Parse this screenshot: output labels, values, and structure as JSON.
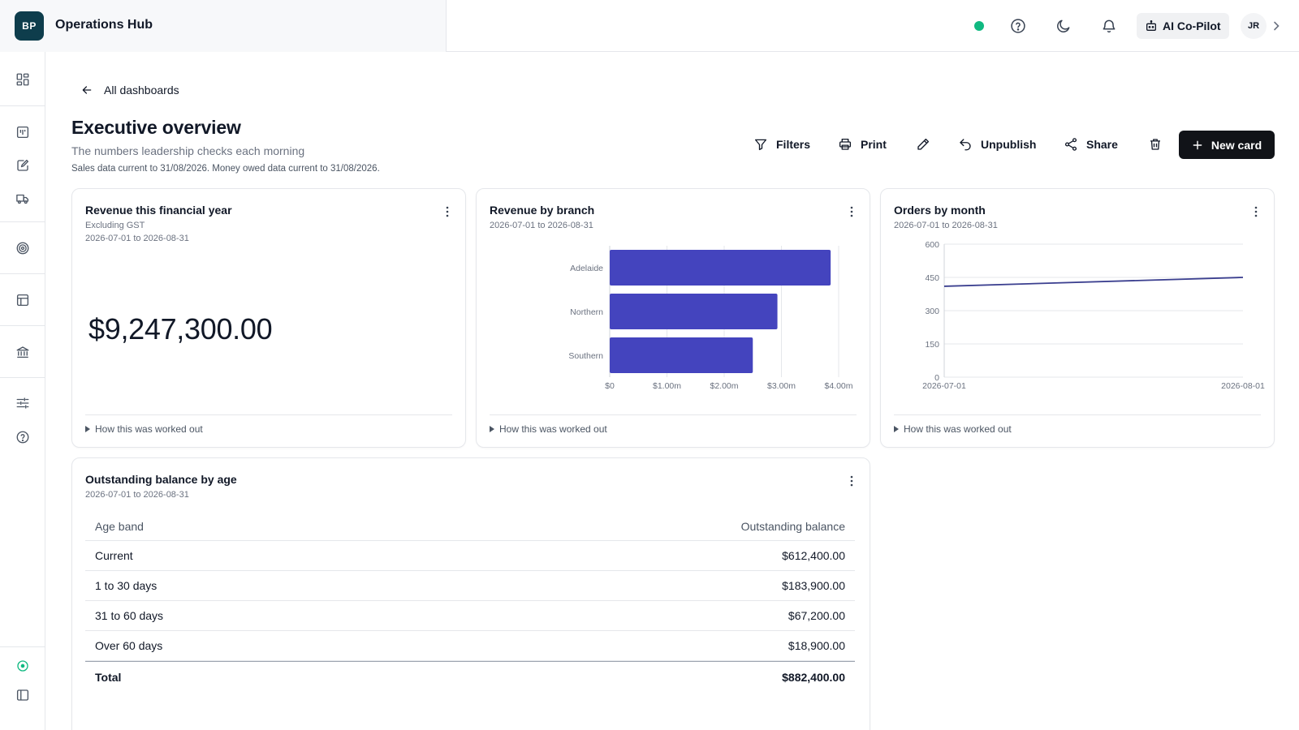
{
  "app": {
    "logo_text": "BP",
    "title": "Operations Hub"
  },
  "topbar": {
    "copilot_label": "AI Co-Pilot",
    "avatar_initials": "JR",
    "status_color": "#10b981"
  },
  "sidebar": {
    "icons": [
      "dashboard-grid-icon",
      "board-icon",
      "edit-document-icon",
      "truck-icon",
      "target-icon",
      "table-icon",
      "bank-icon",
      "sliders-icon",
      "help-circle-icon",
      "status-circle-icon",
      "panel-toggle-icon"
    ]
  },
  "header": {
    "back_label": "All dashboards",
    "title": "Executive overview",
    "subtitle": "The numbers leadership checks each morning",
    "note": "Sales data current to 31/08/2026. Money owed data current to 31/08/2026."
  },
  "toolbar": {
    "filters": "Filters",
    "print": "Print",
    "unpublish": "Unpublish",
    "share": "Share",
    "new_card": "New card"
  },
  "cards": {
    "revenue_fy": {
      "title": "Revenue this financial year",
      "subtitle": "Excluding GST",
      "range": "2026-07-01 to 2026-08-31",
      "value": "$9,247,300.00",
      "footer": "How this was worked out"
    },
    "revenue_branch": {
      "title": "Revenue by branch",
      "range": "2026-07-01 to 2026-08-31",
      "footer": "How this was worked out"
    },
    "orders_month": {
      "title": "Orders by month",
      "range": "2026-07-01 to 2026-08-31",
      "footer": "How this was worked out"
    },
    "balance_age": {
      "title": "Outstanding balance by age",
      "range": "2026-07-01 to 2026-08-31",
      "columns": [
        "Age band",
        "Outstanding balance"
      ],
      "rows": [
        [
          "Current",
          "$612,400.00"
        ],
        [
          "1 to 30 days",
          "$183,900.00"
        ],
        [
          "31 to 60 days",
          "$67,200.00"
        ],
        [
          "Over 60 days",
          "$18,900.00"
        ]
      ],
      "total": [
        "Total",
        "$882,400.00"
      ]
    }
  },
  "chart_data": [
    {
      "type": "bar",
      "orientation": "horizontal",
      "categories": [
        "Adelaide",
        "Northern",
        "Southern"
      ],
      "values": [
        3.86,
        2.93,
        2.5
      ],
      "unit": "$m",
      "xlim": [
        0,
        4
      ],
      "x_ticks": [
        "$0",
        "$1.00m",
        "$2.00m",
        "$3.00m",
        "$4.00m"
      ],
      "grid": true,
      "color": "#4444be"
    },
    {
      "type": "line",
      "x": [
        "2026-07-01",
        "2026-08-01"
      ],
      "values": [
        410,
        450
      ],
      "ylim": [
        0,
        600
      ],
      "y_ticks": [
        "0",
        "150",
        "300",
        "450",
        "600"
      ],
      "grid": true,
      "color": "#3b3f8f"
    }
  ]
}
